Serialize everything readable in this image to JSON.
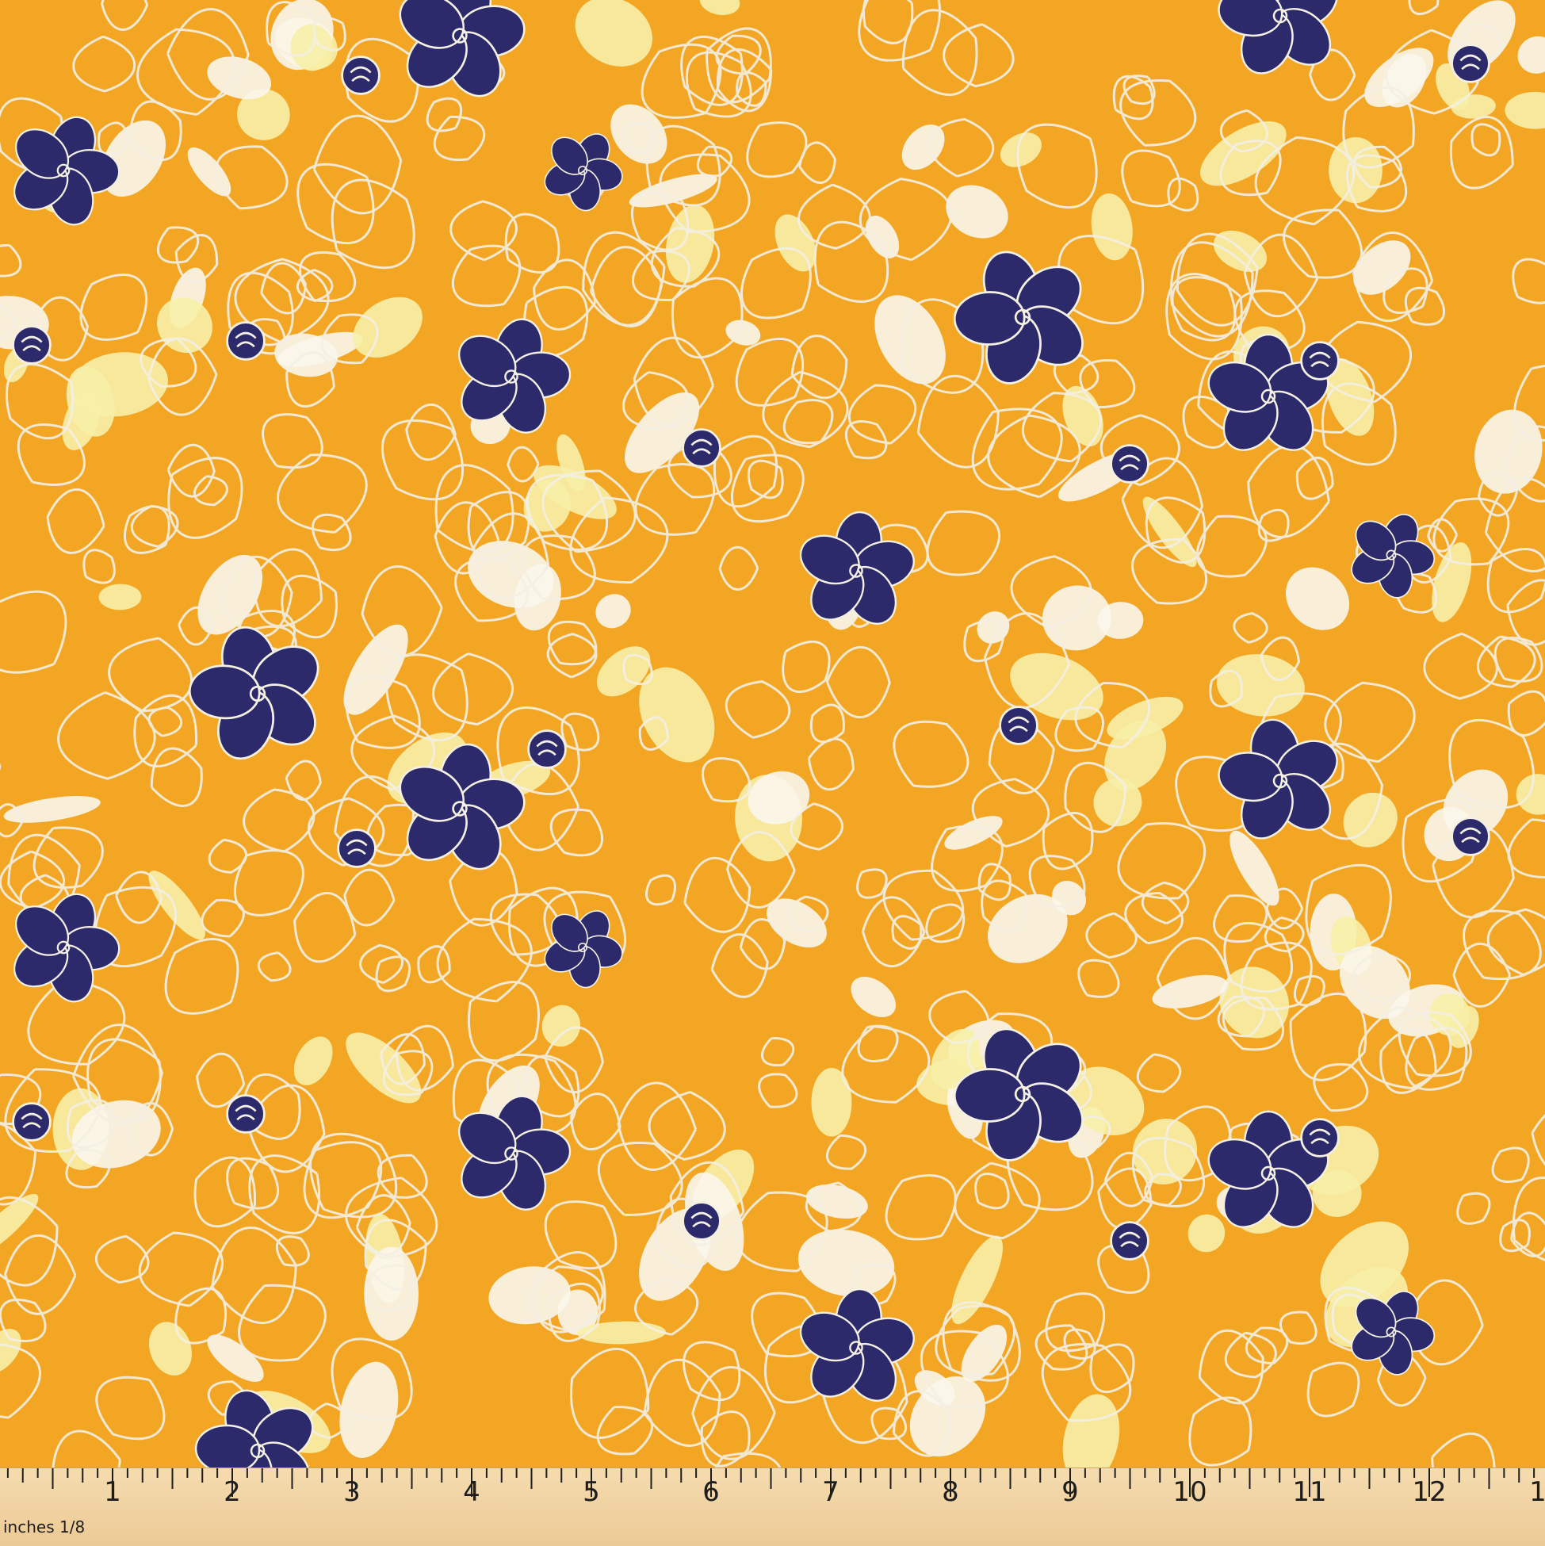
{
  "image": {
    "subject": "printed floral fabric swatch",
    "colors": {
      "background": "#f2a623",
      "outline": "#f4f0e4",
      "pale_yellow": "#f7f0a8",
      "cream": "#faf6ec",
      "navy": "#2c2a6b",
      "ruler": "#f2d6a6"
    }
  },
  "ruler": {
    "unit_label": "inches 1/8",
    "numbers": [
      "1",
      "2",
      "3",
      "4",
      "5",
      "6",
      "7",
      "8",
      "9",
      "10",
      "11",
      "12",
      "1"
    ]
  }
}
